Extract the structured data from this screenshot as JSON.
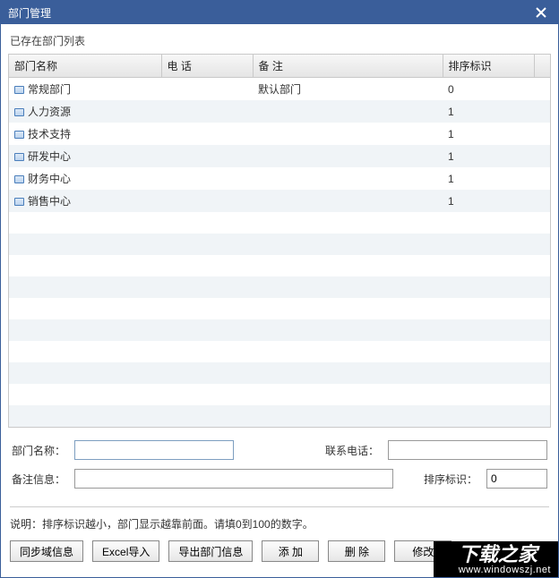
{
  "titlebar": {
    "title": "部门管理"
  },
  "subtitle": "已存在部门列表",
  "columns": {
    "name": "部门名称",
    "phone": "电 话",
    "remark": "备 注",
    "sort": "排序标识"
  },
  "rows": [
    {
      "name": "常规部门",
      "phone": "",
      "remark": "默认部门",
      "sort": "0"
    },
    {
      "name": "人力资源",
      "phone": "",
      "remark": "",
      "sort": "1"
    },
    {
      "name": "技术支持",
      "phone": "",
      "remark": "",
      "sort": "1"
    },
    {
      "name": "研发中心",
      "phone": "",
      "remark": "",
      "sort": "1"
    },
    {
      "name": "财务中心",
      "phone": "",
      "remark": "",
      "sort": "1"
    },
    {
      "name": "销售中心",
      "phone": "",
      "remark": "",
      "sort": "1"
    }
  ],
  "form": {
    "name_label": "部门名称：",
    "name_value": "",
    "phone_label": "联系电话：",
    "phone_value": "",
    "remark_label": "备注信息：",
    "remark_value": "",
    "sort_label": "排序标识：",
    "sort_value": "0"
  },
  "hint": "说明：排序标识越小，部门显示越靠前面。请填0到100的数字。",
  "buttons": {
    "sync": "同步域信息",
    "import": "Excel导入",
    "export": "导出部门信息",
    "add": "添 加",
    "del": "删 除",
    "edit": "修改"
  },
  "watermark": {
    "line1": "下载之家",
    "line2": "www.windowszj.net"
  }
}
